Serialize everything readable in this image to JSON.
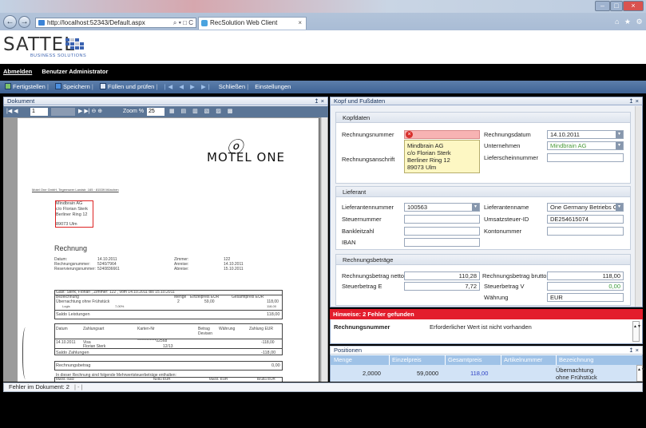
{
  "browser": {
    "url": "http://localhost:52343/Default.aspx",
    "addr_controls": "⌕ ▾ □ C",
    "tab_title": "RecSolution Web Client",
    "tab_close": "×",
    "back": "←",
    "forward": "→",
    "window_min": "–",
    "window_max": "□",
    "window_close": "×",
    "right_icons": "⌂ ★ ⚙"
  },
  "header": {
    "logo": "SATTEL",
    "logo_sub": "BUSINESS SOLUTIONS",
    "logout": "Abmelden",
    "user": "Benutzer Administrator"
  },
  "toolbar": {
    "items": [
      "Fertigstellen",
      "Speichern",
      "Füllen und prüfen",
      "Schließen",
      "Einstellungen"
    ]
  },
  "document_panel": {
    "title": "Dokument",
    "pin": "↥ ×",
    "page": "1",
    "zoom_label": "Zoom %",
    "zoom": "25"
  },
  "invoice": {
    "brand": "MOTEL ONE",
    "sender": "Motel One GmbH, Tegernseer Landstr. 165 · 81539 München",
    "addr1": "Mindbrain AG",
    "addr2": "c/o Florian Sterk",
    "addr3": "Berliner Ring 12",
    "addr4": "89073 Ulm",
    "heading": "Rechnung",
    "d_lbl": "Datum:",
    "d_val": "14.10.2011",
    "nr_lbl": "Rechnungsnummer:",
    "nr_val": "5240/7964",
    "res_lbl": "Reservierungsnummer:",
    "res_val": "5240836661",
    "z_lbl": "Zimmer:",
    "z_val": "122",
    "an_lbl": "Anreise:",
    "an_val": "14.10.2011",
    "ab_lbl": "Abreise:",
    "ab_val": "15.10.2011",
    "guest_line": "Gast: Sterk, Florian , Zimmer: 122 , vom 14.10.2011 bis 15.10.2011",
    "col1": "Bezeichnung",
    "col2": "Menge",
    "col3": "Einzelpreis EUR",
    "col4": "Gesamtpreis EUR",
    "item1": "Übernachtung ohne Frühstück",
    "item1_qty": "2",
    "item1_price": "59,00",
    "item1_total": "118,00",
    "logis": "Logis",
    "logis_pct": "7,00%",
    "logis_total": "118,00",
    "saldo_leistungen": "Saldo Leistungen",
    "saldo_leistungen_val": "118,00",
    "p_datum": "Datum",
    "p_art": "Zahlungsart",
    "p_karte": "Karten-Nr",
    "p_betrag": "Betrag Devisen",
    "p_waehrung": "Währung",
    "p_zahlung": "Zahlung EUR",
    "p_date": "14.10.2011",
    "p_visa": "Visa",
    "p_name": "Florian Sterk",
    "p_card": "************02568",
    "p_exp": "12/13",
    "p_amount": "-118,00",
    "saldo_zahlungen": "Saldo Zahlungen",
    "saldo_zahlungen_val": "-118,00",
    "rechnungsbetrag": "Rechnungsbetrag",
    "rechnungsbetrag_val": "0,00",
    "mwst_intro": "In dieser Rechnung sind folgende Mehrwertsteuerbeträge enthalten:",
    "mwst_col1": "MwSt.-Satz",
    "mwst_col2": "Netto EUR",
    "mwst_col3": "MwSt. EUR",
    "mwst_col4": "Brutto EUR",
    "mwst_r1a": "19,00 %",
    "mwst_r1b": "0,00",
    "mwst_r1c": "0,00",
    "mwst_r1d": "0,00",
    "mwst_r2a": "7,00 %",
    "mwst_r2b": "110,28",
    "mwst_r2c": "7,72",
    "mwst_r2d": "118,00"
  },
  "right_panel": {
    "title": "Kopf und Fußdaten",
    "pin": "↥ ×",
    "kopf": {
      "title": "Kopfdaten",
      "rechnungsnummer_lbl": "Rechnungsnummer",
      "rechnungsnummer_val": "",
      "rechnungsdatum_lbl": "Rechnungsdatum",
      "rechnungsdatum_val": "14.10.2011",
      "unternehmen_lbl": "Unternehmen",
      "unternehmen_val": "Mindbrain AG",
      "lieferschein_lbl": "Lieferscheinnummer",
      "anschrift_lbl": "Rechnungsanschrift",
      "anschrift1": "Mindbrain AG",
      "anschrift2": "c/o Florian Sterk",
      "anschrift3": "Berliner Ring 12",
      "anschrift4": "89073 Ulm"
    },
    "lieferant": {
      "title": "Lieferant",
      "nr_lbl": "Lieferantennummer",
      "nr_val": "100563",
      "name_lbl": "Lieferantenname",
      "name_val": "One Germany Betriebs G",
      "steuer_lbl": "Steuernummer",
      "ust_lbl": "Umsatzsteuer-ID",
      "ust_val": "DE254615074",
      "bank_lbl": "Bankleitzahl",
      "konto_lbl": "Kontonummer",
      "iban_lbl": "IBAN"
    },
    "betraege": {
      "title": "Rechnungsbeträge",
      "netto_lbl": "Rechnungsbetrag netto",
      "netto_val": "110,28",
      "brutto_lbl": "Rechnungsbetrag brutto",
      "brutto_val": "118,00",
      "steuerE_lbl": "Steuerbetrag E",
      "steuerE_val": "7,72",
      "steuerV_lbl": "Steuerbetrag V",
      "steuerV_val": "0,00",
      "waehrung_lbl": "Währung",
      "waehrung_val": "EUR"
    }
  },
  "errors": {
    "title": "Hinweise: 2 Fehler gefunden",
    "field": "Rechnungsnummer",
    "message": "Erforderlicher Wert ist nicht vorhanden"
  },
  "positions": {
    "title": "Positionen",
    "pin": "↥ ×",
    "columns": [
      "Menge",
      "Einzelpreis",
      "Gesamtpreis",
      "Artikelnummer",
      "Bezeichnung"
    ],
    "row": {
      "menge": "2,0000",
      "einzelpreis": "59,0000",
      "gesamtpreis": "118,00",
      "artikelnummer": "",
      "bezeichnung1": "Übernachtung",
      "bezeichnung2": "ohne Frühstück"
    }
  },
  "status": {
    "text": "Fehler im Dokument: 2",
    "sep": "|  -  |"
  }
}
